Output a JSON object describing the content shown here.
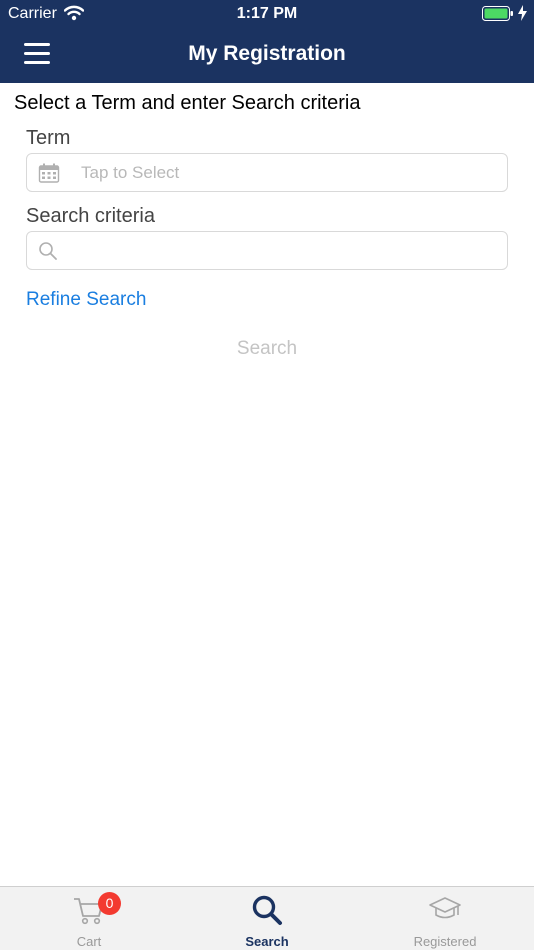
{
  "status_bar": {
    "carrier": "Carrier",
    "time": "1:17 PM",
    "battery_icon": "battery-full-icon",
    "wifi_icon": "wifi-icon"
  },
  "header": {
    "title": "My Registration",
    "menu_icon": "hamburger-menu-icon",
    "background_color": "#1b3361"
  },
  "form": {
    "instruction": "Select a Term and enter Search criteria",
    "term_label": "Term",
    "term_placeholder": "Tap to Select",
    "term_icon": "calendar-icon",
    "search_label": "Search criteria",
    "search_value": "",
    "search_icon": "search-icon",
    "refine_link": "Refine Search",
    "search_button": "Search",
    "link_color": "#1a7ee0"
  },
  "tabs": [
    {
      "label": "Cart",
      "icon": "cart-icon",
      "badge": "0",
      "active": false
    },
    {
      "label": "Search",
      "icon": "search-icon",
      "active": true
    },
    {
      "label": "Registered",
      "icon": "graduation-cap-icon",
      "active": false
    }
  ]
}
